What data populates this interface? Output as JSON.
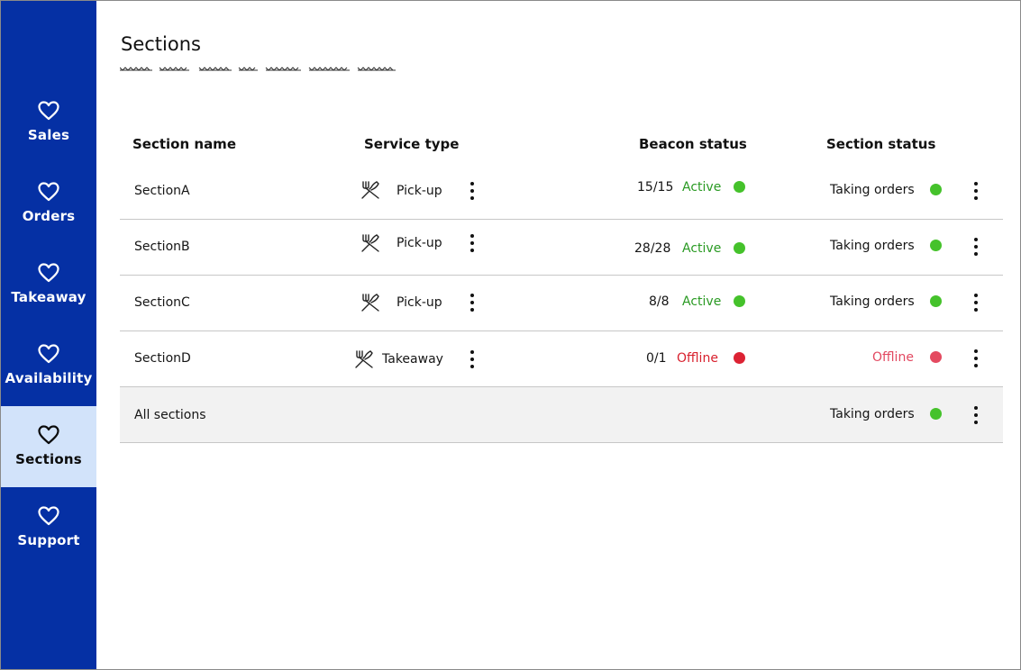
{
  "colors": {
    "sidebar": "#0530a4",
    "sidebar_active": "#d2e3fa",
    "active_green": "#45c22b",
    "offline_red": "#dc2233"
  },
  "sidebar": {
    "items": [
      {
        "label": "Sales",
        "icon": "heart-icon"
      },
      {
        "label": "Orders",
        "icon": "heart-icon"
      },
      {
        "label": "Takeaway",
        "icon": "heart-icon"
      },
      {
        "label": "Availability",
        "icon": "heart-icon"
      },
      {
        "label": "Sections",
        "icon": "heart-icon",
        "active": true
      },
      {
        "label": "Support",
        "icon": "heart-icon"
      }
    ]
  },
  "page": {
    "title": "Sections"
  },
  "table": {
    "headers": {
      "section_name": "Section name",
      "service_type": "Service type",
      "beacon_status": "Beacon status",
      "section_status": "Section status"
    },
    "rows": [
      {
        "name": "SectionA",
        "service_icon": "fork-knife-icon",
        "service": "Pick-up",
        "beacon_count": "15/15",
        "beacon_status": "Active",
        "section_status": "Taking orders"
      },
      {
        "name": "SectionB",
        "service_icon": "fork-knife-icon",
        "service": "Pick-up",
        "beacon_count": "28/28",
        "beacon_status": "Active",
        "section_status": "Taking orders"
      },
      {
        "name": "SectionC",
        "service_icon": "fork-knife-icon",
        "service": "Pick-up",
        "beacon_count": "8/8",
        "beacon_status": "Active",
        "section_status": "Taking orders"
      },
      {
        "name": "SectionD",
        "service_icon": "fork-knife-icon",
        "service": "Takeaway",
        "beacon_count": "0/1",
        "beacon_status": "Offline",
        "section_status": "Offline"
      }
    ],
    "summary": {
      "name": "All sections",
      "section_status": "Taking orders"
    }
  }
}
